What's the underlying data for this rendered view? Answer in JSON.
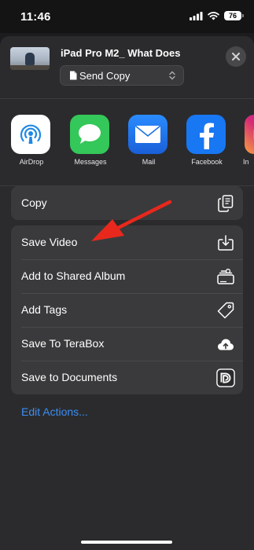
{
  "status_bar": {
    "time": "11:46",
    "battery": "76"
  },
  "header": {
    "title": "iPad Pro M2_ What Does",
    "send_option": "Send Copy"
  },
  "apps": [
    {
      "name": "AirDrop",
      "icon": "airdrop-icon",
      "color": "#ffffff"
    },
    {
      "name": "Messages",
      "icon": "messages-icon",
      "color": "#34c759"
    },
    {
      "name": "Mail",
      "icon": "mail-icon",
      "color": "#1e7cf2"
    },
    {
      "name": "Facebook",
      "icon": "facebook-icon",
      "color": "#1877f2"
    },
    {
      "name": "In",
      "icon": "instagram-icon",
      "color": "#c13584"
    }
  ],
  "actions": {
    "copy": {
      "label": "Copy",
      "icon": "copy-icon"
    },
    "items": [
      {
        "label": "Save Video",
        "icon": "save-video-icon"
      },
      {
        "label": "Add to Shared Album",
        "icon": "shared-album-icon"
      },
      {
        "label": "Add Tags",
        "icon": "tag-icon"
      },
      {
        "label": "Save To TeraBox",
        "icon": "cloud-upload-icon"
      },
      {
        "label": "Save to Documents",
        "icon": "documents-app-icon"
      }
    ]
  },
  "edit_actions": "Edit Actions...",
  "colors": {
    "accent": "#3a8ef6",
    "annotation_arrow": "#e8281d"
  }
}
